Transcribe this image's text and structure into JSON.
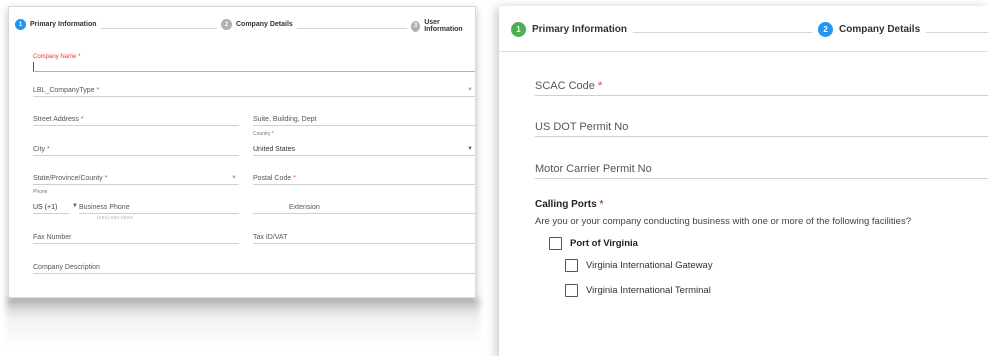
{
  "left": {
    "steps": [
      {
        "number": "1",
        "label": "Primary Information"
      },
      {
        "number": "2",
        "label": "Company Details"
      },
      {
        "number": "3",
        "label": "User Information"
      }
    ],
    "company_name_label": "Company Name",
    "required_mark": "*",
    "company_type_label": "LBL_CompanyType",
    "street_label": "Street Address",
    "suite_label": "Suite, Building, Dept",
    "city_label": "City",
    "country_small_label": "Country",
    "country_value": "United States",
    "state_label": "State/Province/County",
    "postal_label": "Postal Code",
    "phone_small_label": "Phone",
    "phone_code": "US (+1)",
    "business_phone_label": "Business Phone",
    "phone_hint": "(XXX) XXX-XXXX",
    "extension_label": "Extension",
    "fax_label": "Fax Number",
    "tax_label": "Tax ID/VAT",
    "description_label": "Company Description"
  },
  "right": {
    "steps": [
      {
        "number": "1",
        "label": "Primary Information"
      },
      {
        "number": "2",
        "label": "Company Details"
      }
    ],
    "scac_label": "SCAC Code",
    "required_mark": "*",
    "usdot_label": "US DOT Permit No",
    "motor_label": "Motor Carrier Permit No",
    "calling_ports_label": "Calling Ports",
    "question": "Are you or your company conducting business with one or more of the following facilities?",
    "ports": [
      {
        "label": "Port of Virginia"
      },
      {
        "label": "Virginia International Gateway"
      },
      {
        "label": "Virginia International Terminal"
      }
    ]
  },
  "colors": {
    "active_step": "#2196f3",
    "completed_step": "#4caf50",
    "pending_step": "#b0b0b0",
    "required": "#e53935"
  }
}
